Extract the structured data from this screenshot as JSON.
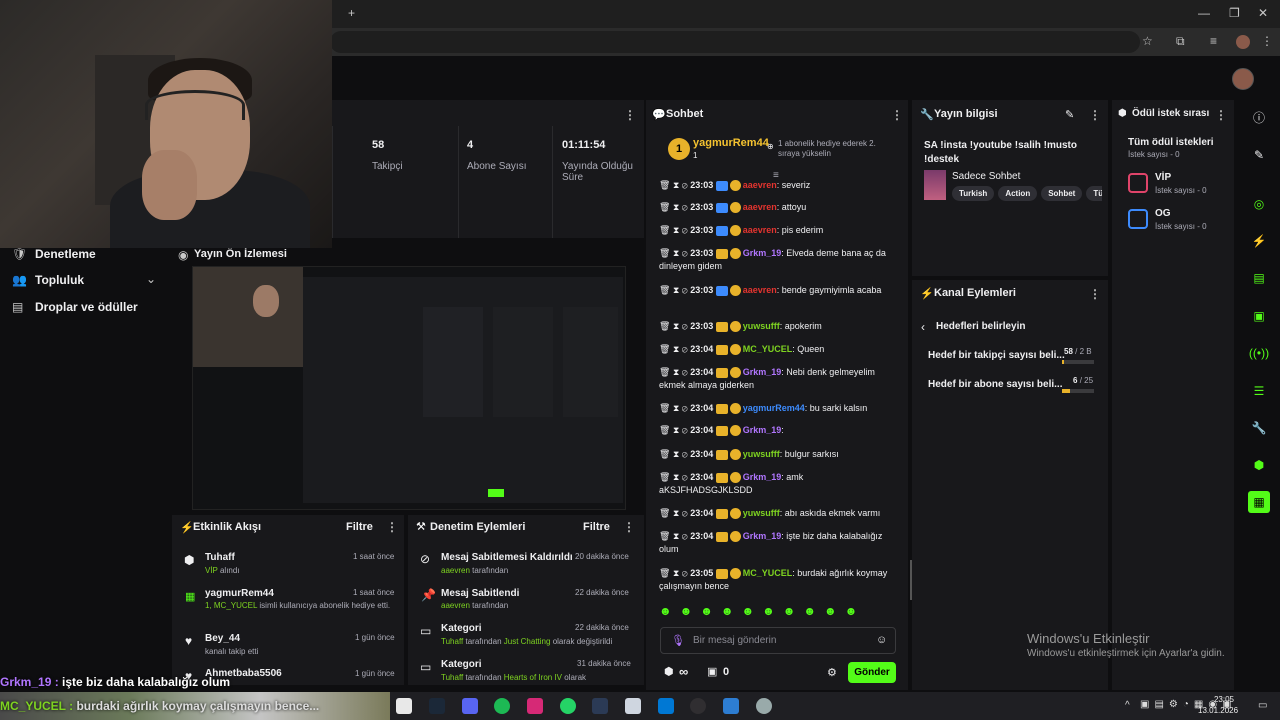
{
  "browser": {
    "new_tab": "+"
  },
  "sidebar": {
    "items": [
      {
        "label": "Denetleme"
      },
      {
        "label": "Topluluk"
      },
      {
        "label": "Droplar ve ödüller"
      }
    ]
  },
  "stats": [
    {
      "value": "58",
      "label": "Takipçi"
    },
    {
      "value": "4",
      "label": "Abone Sayısı"
    },
    {
      "value": "01:11:54",
      "label": "Yayında Olduğu Süre"
    }
  ],
  "preview": {
    "title": "Yayın Ön İzlemesi"
  },
  "activity": {
    "title": "Etkinlik Akışı",
    "filter": "Filtre",
    "items": [
      {
        "name": "Tuhaff",
        "sub": "VİP",
        "sub2": "alındı",
        "time": "1 saat önce"
      },
      {
        "name": "yagmurRem44",
        "sub": "1, MC_YUCEL",
        "sub2": "isimli kullanıcıya abonelik hediye etti.",
        "time": "1 saat önce"
      },
      {
        "name": "Bey_44",
        "sub": "",
        "sub2": "kanalı takip etti",
        "time": "1 gün önce"
      },
      {
        "name": "Ahmetbaba5506",
        "sub": "",
        "sub2": "",
        "time": "1 gün önce"
      }
    ]
  },
  "moderation": {
    "title": "Denetim Eylemleri",
    "filter": "Filtre",
    "items": [
      {
        "title": "Mesaj Sabitlemesi Kaldırıldı",
        "time": "20 dakika önce",
        "by": "aaevren",
        "rest": "tarafından"
      },
      {
        "title": "Mesaj Sabitlendi",
        "time": "22 dakika önce",
        "by": "aaevren",
        "rest": "tarafından"
      },
      {
        "title": "Kategori",
        "time": "22 dakika önce",
        "by": "Tuhaff",
        "rest": "tarafından",
        "cat": "Just Chatting",
        "rest2": "olarak değiştirildi"
      },
      {
        "title": "Kategori",
        "time": "31 dakika önce",
        "by": "Tuhaff",
        "rest": "tarafından",
        "cat": "Hearts of Iron IV",
        "rest2": "olarak"
      }
    ]
  },
  "chat": {
    "title": "Sohbet",
    "pinned_user": "yagmurRem44",
    "pinned_count": "1",
    "pinned_note": "1 abonelik hediye ederek 2. sıraya yükselin",
    "messages": [
      {
        "time": "23:03",
        "user": "aaevren",
        "color": "red",
        "text": "severiz"
      },
      {
        "time": "23:03",
        "user": "aaevren",
        "color": "red",
        "text": "attoyu"
      },
      {
        "time": "23:03",
        "user": "aaevren",
        "color": "red",
        "text": "pis ederim"
      },
      {
        "time": "23:03",
        "user": "Grkm_19",
        "color": "purple",
        "text": "Elveda deme bana aç da dinleyem gidem"
      },
      {
        "time": "23:03",
        "user": "aaevren",
        "color": "red",
        "text": "bende gaymiyimla acaba"
      },
      {
        "time": "23:03",
        "user": "yuwsufff",
        "color": "green",
        "text": "apokerim"
      },
      {
        "time": "23:04",
        "user": "MC_YUCEL",
        "color": "green",
        "text": "Queen"
      },
      {
        "time": "23:04",
        "user": "Grkm_19",
        "color": "purple",
        "text": "Nebi denk gelmeyelim ekmek almaya giderken"
      },
      {
        "time": "23:04",
        "user": "yagmurRem44",
        "color": "blue",
        "text": "bu sarki kalsın"
      },
      {
        "time": "23:04",
        "user": "Grkm_19",
        "color": "purple",
        "text": ""
      },
      {
        "time": "23:04",
        "user": "yuwsufff",
        "color": "green",
        "text": "bulgur sarkısı"
      },
      {
        "time": "23:04",
        "user": "Grkm_19",
        "color": "purple",
        "text": "amk aKSJFHADSGJKLSDD"
      },
      {
        "time": "23:04",
        "user": "yuwsufff",
        "color": "green",
        "text": "abı askıda ekmek varmı"
      },
      {
        "time": "23:04",
        "user": "Grkm_19",
        "color": "purple",
        "text": "işte biz daha kalabalığız olum"
      },
      {
        "time": "23:05",
        "user": "MC_YUCEL",
        "color": "green",
        "text": "burdaki ağırlık koymay çalışmayın bence"
      }
    ],
    "input_placeholder": "Bir mesaj gönderin",
    "infinity": "∞",
    "count": "0",
    "send": "Gönder"
  },
  "stream_info": {
    "header": "Yayın bilgisi",
    "title": "SA !insta !youtube !salih !musto !destek",
    "category": "Sadece Sohbet",
    "tags": [
      "Turkish",
      "Action",
      "Sohbet",
      "Tür"
    ]
  },
  "channel_actions": {
    "header": "Kanal Eylemleri",
    "back": "Hedefleri belirleyin",
    "goals": [
      {
        "label": "Hedef bir takipçi sayısı beli...",
        "current": "58",
        "target": "/ 2 B",
        "progress": 0.029
      },
      {
        "label": "Hedef bir abone sayısı beli...",
        "current": "6",
        "target": "/ 25",
        "progress": 0.24
      }
    ]
  },
  "rewards": {
    "header": "Ödül istek sırası",
    "all": "Tüm ödül istekleri",
    "all_sub": "İstek sayısı - 0",
    "items": [
      {
        "name": "VİP",
        "sub": "İstek sayısı - 0",
        "color": "#e0446a"
      },
      {
        "name": "OG",
        "sub": "İstek sayısı - 0",
        "color": "#3d8bfd"
      }
    ]
  },
  "watermark": {
    "line1": "Windows'u Etkinleştir",
    "line2": "Windows'u etkinleştirmek için Ayarlar'a gidin."
  },
  "overlay": {
    "line1_user": "Grkm_19 :",
    "line1_text": "işte biz daha kalabalığız olum",
    "line2_user": "MC_YUCEL :",
    "line2_text": "burdaki ağırlık koymay çalışmayın bence..."
  },
  "taskbar": {
    "time": "23:05",
    "date": "13.01.2026"
  },
  "colors": {
    "accent": "#53fc18",
    "panel": "#18181b",
    "bg": "#0e0e10"
  }
}
